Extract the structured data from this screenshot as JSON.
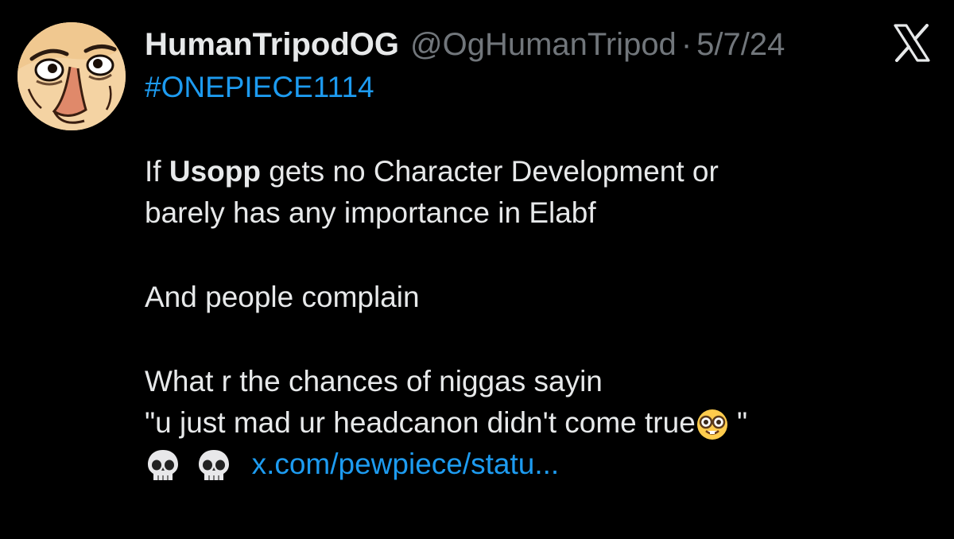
{
  "author": {
    "display_name": "HumanTripodOG",
    "handle": "@OgHumanTripod",
    "separator": "·",
    "date": "5/7/24"
  },
  "platform_icon": "x-logo-icon",
  "tweet": {
    "hashtag": "#ONEPIECE1114",
    "line1_prefix": "If ",
    "line1_bold": "Usopp",
    "line1_suffix": " gets no Character Development or",
    "line2": "barely has any importance in Elabf",
    "line3": "And people complain",
    "line4": "What r the chances of niggas sayin",
    "line5_text": "\"u just mad ur headcanon didn't come true",
    "line5_end": " \"",
    "link_text": "x.com/pewpiece/statu..."
  },
  "emojis": {
    "nerd": "nerd-face-emoji",
    "skull": "skull-emoji"
  },
  "colors": {
    "background": "#000000",
    "text": "#e7e9ea",
    "muted": "#71767b",
    "link": "#1d9bf0"
  }
}
